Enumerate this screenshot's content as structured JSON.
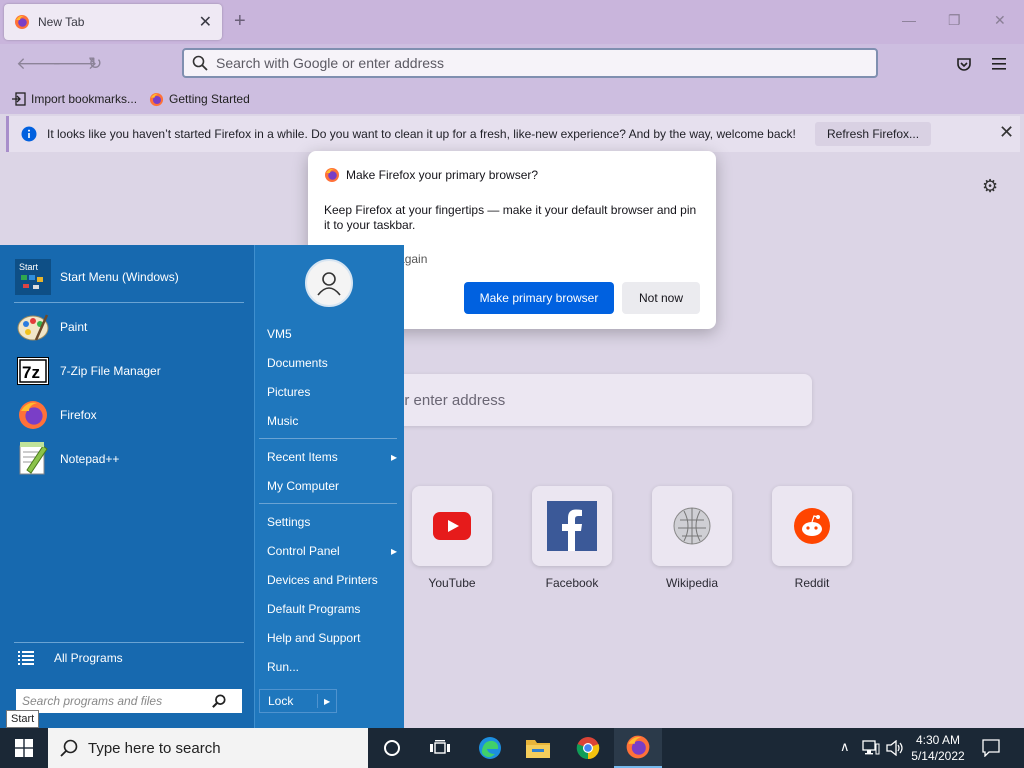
{
  "browser": {
    "tab": {
      "label": "New Tab",
      "close": "✕"
    },
    "new_tab": "+",
    "window_controls": {
      "minimize": "—",
      "maximize": "❐",
      "close": "✕"
    },
    "urlbar": {
      "placeholder": "Search with Google or enter address"
    },
    "bookmarks": [
      {
        "label": "Import bookmarks..."
      },
      {
        "label": "Getting Started"
      }
    ],
    "notice": {
      "text": "It looks like you haven’t started Firefox in a while. Do you want to clean it up for a fresh, like-new experience? And by the way, welcome back!",
      "button": "Refresh Firefox...",
      "close": "✕"
    },
    "newtab": {
      "search_text": "or enter address",
      "sites": [
        {
          "label": "YouTube",
          "icon": "youtube-icon"
        },
        {
          "label": "Facebook",
          "icon": "facebook-icon"
        },
        {
          "label": "Wikipedia",
          "icon": "wikipedia-icon"
        },
        {
          "label": "Reddit",
          "icon": "reddit-icon"
        }
      ]
    }
  },
  "popup": {
    "title": "Make Firefox your primary browser?",
    "body": "Keep Firefox at your fingertips — make it your default browser and pin it to your taskbar.",
    "checkbox_label": "this message again",
    "primary_button": "Make primary browser",
    "secondary_button": "Not now"
  },
  "start_menu": {
    "programs": [
      {
        "label": "Start Menu (Windows)",
        "icon": "start-menu-app-icon"
      },
      {
        "label": "Paint",
        "icon": "paint-icon"
      },
      {
        "label": "7-Zip File Manager",
        "icon": "seven-zip-icon"
      },
      {
        "label": "Firefox",
        "icon": "firefox-icon"
      },
      {
        "label": "Notepad++",
        "icon": "notepad-plus-plus-icon"
      }
    ],
    "start_app_badge": "Start",
    "seven_zip_badge": "7z",
    "all_programs": "All Programs",
    "search_placeholder": "Search programs and files",
    "right_items": [
      {
        "label": "VM5"
      },
      {
        "label": "Documents"
      },
      {
        "label": "Pictures"
      },
      {
        "label": "Music"
      },
      {
        "label": "Recent Items",
        "arrow": "▸"
      },
      {
        "label": "My Computer"
      },
      {
        "label": "Settings"
      },
      {
        "label": "Control Panel",
        "arrow": "▸"
      },
      {
        "label": "Devices and Printers"
      },
      {
        "label": "Default Programs"
      },
      {
        "label": "Help and Support"
      },
      {
        "label": "Run..."
      }
    ],
    "lock": "Lock",
    "lock_arrow": "▶",
    "tooltip": "Start"
  },
  "taskbar": {
    "search_placeholder": "Type here to search",
    "time": "4:30 AM",
    "date": "5/14/2022",
    "tray_chevron": "∧"
  },
  "colors": {
    "start_menu_bg": "#1a6bb1",
    "primary_button": "#0061e0",
    "taskbar_bg": "#1b2836"
  }
}
